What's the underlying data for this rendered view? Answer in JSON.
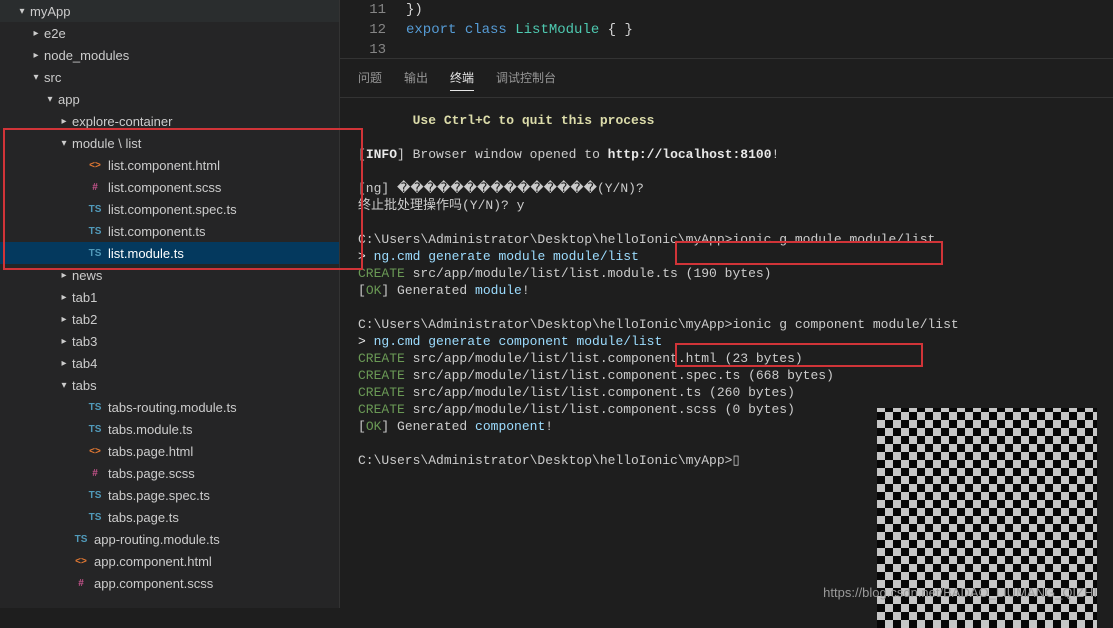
{
  "editor": {
    "lines": [
      {
        "num": "11",
        "html": "})"
      },
      {
        "num": "12",
        "html": "<span class='kw'>export</span> <span class='kw'>class</span> <span class='cls'>ListModule</span> { }"
      },
      {
        "num": "13",
        "html": ""
      }
    ]
  },
  "tree": [
    {
      "indent": 1,
      "chev": "▾",
      "icon": "",
      "cls": "",
      "label": "myApp"
    },
    {
      "indent": 2,
      "chev": "▸",
      "icon": "",
      "cls": "",
      "label": "e2e"
    },
    {
      "indent": 2,
      "chev": "▸",
      "icon": "",
      "cls": "",
      "label": "node_modules"
    },
    {
      "indent": 2,
      "chev": "▾",
      "icon": "",
      "cls": "",
      "label": "src"
    },
    {
      "indent": 3,
      "chev": "▾",
      "icon": "",
      "cls": "",
      "label": "app"
    },
    {
      "indent": 4,
      "chev": "▸",
      "icon": "",
      "cls": "",
      "label": "explore-container"
    },
    {
      "indent": 4,
      "chev": "▾",
      "icon": "",
      "cls": "",
      "label": "module \\ list"
    },
    {
      "indent": 5,
      "chev": "",
      "icon": "<>",
      "cls": "i-html",
      "label": "list.component.html"
    },
    {
      "indent": 5,
      "chev": "",
      "icon": "#",
      "cls": "i-scss",
      "label": "list.component.scss"
    },
    {
      "indent": 5,
      "chev": "",
      "icon": "TS",
      "cls": "i-ts",
      "label": "list.component.spec.ts"
    },
    {
      "indent": 5,
      "chev": "",
      "icon": "TS",
      "cls": "i-ts",
      "label": "list.component.ts"
    },
    {
      "indent": 5,
      "chev": "",
      "icon": "TS",
      "cls": "i-ts",
      "label": "list.module.ts",
      "selected": true
    },
    {
      "indent": 4,
      "chev": "▸",
      "icon": "",
      "cls": "",
      "label": "news"
    },
    {
      "indent": 4,
      "chev": "▸",
      "icon": "",
      "cls": "",
      "label": "tab1"
    },
    {
      "indent": 4,
      "chev": "▸",
      "icon": "",
      "cls": "",
      "label": "tab2"
    },
    {
      "indent": 4,
      "chev": "▸",
      "icon": "",
      "cls": "",
      "label": "tab3"
    },
    {
      "indent": 4,
      "chev": "▸",
      "icon": "",
      "cls": "",
      "label": "tab4"
    },
    {
      "indent": 4,
      "chev": "▾",
      "icon": "",
      "cls": "",
      "label": "tabs"
    },
    {
      "indent": 5,
      "chev": "",
      "icon": "TS",
      "cls": "i-ts",
      "label": "tabs-routing.module.ts"
    },
    {
      "indent": 5,
      "chev": "",
      "icon": "TS",
      "cls": "i-ts",
      "label": "tabs.module.ts"
    },
    {
      "indent": 5,
      "chev": "",
      "icon": "<>",
      "cls": "i-html",
      "label": "tabs.page.html"
    },
    {
      "indent": 5,
      "chev": "",
      "icon": "#",
      "cls": "i-scss",
      "label": "tabs.page.scss"
    },
    {
      "indent": 5,
      "chev": "",
      "icon": "TS",
      "cls": "i-ts",
      "label": "tabs.page.spec.ts"
    },
    {
      "indent": 5,
      "chev": "",
      "icon": "TS",
      "cls": "i-ts",
      "label": "tabs.page.ts"
    },
    {
      "indent": 4,
      "chev": "",
      "icon": "TS",
      "cls": "i-ts",
      "label": "app-routing.module.ts"
    },
    {
      "indent": 4,
      "chev": "",
      "icon": "<>",
      "cls": "i-html",
      "label": "app.component.html"
    },
    {
      "indent": 4,
      "chev": "",
      "icon": "#",
      "cls": "i-scss",
      "label": "app.component.scss"
    }
  ],
  "panelTabs": {
    "items": [
      "问题",
      "输出",
      "终端",
      "调试控制台"
    ],
    "activeIndex": 2
  },
  "terminal": {
    "lines": [
      {
        "cls": "ylw bld",
        "text": "       Use Ctrl+C to quit this process"
      },
      {
        "text": ""
      },
      {
        "html": "[<span class='wht bld'>INFO</span>] Browser window opened to <span class='wht bld'>http://localhost:8100</span>!"
      },
      {
        "text": ""
      },
      {
        "text": "[ng] ���������������(Y/N)?"
      },
      {
        "text": "终止批处理操作吗(Y/N)? y"
      },
      {
        "text": ""
      },
      {
        "text": "C:\\Users\\Administrator\\Desktop\\helloIonic\\myApp>ionic g module module/list"
      },
      {
        "html": "<span class='wht'>></span> <span class='cyn'>ng.cmd generate module module/list</span>"
      },
      {
        "html": "<span class='grn'>CREATE</span> src/app/module/list/list.module.ts (190 bytes)"
      },
      {
        "html": "[<span class='grn'>OK</span>] Generated <span class='cyn'>module</span>!"
      },
      {
        "text": ""
      },
      {
        "text": "C:\\Users\\Administrator\\Desktop\\helloIonic\\myApp>ionic g component module/list"
      },
      {
        "html": "<span class='wht'>></span> <span class='cyn'>ng.cmd generate component module/list</span>"
      },
      {
        "html": "<span class='grn'>CREATE</span> src/app/module/list/list.component.html (23 bytes)"
      },
      {
        "html": "<span class='grn'>CREATE</span> src/app/module/list/list.component.spec.ts (668 bytes)"
      },
      {
        "html": "<span class='grn'>CREATE</span> src/app/module/list/list.component.ts (260 bytes)"
      },
      {
        "html": "<span class='grn'>CREATE</span> src/app/module/list/list.component.scss (0 bytes)"
      },
      {
        "html": "[<span class='grn'>OK</span>] Generated <span class='cyn'>component</span>!"
      },
      {
        "text": ""
      },
      {
        "text": "C:\\Users\\Administrator\\Desktop\\helloIonic\\myApp>▯"
      }
    ]
  },
  "watermark": "https://blog.csdn.net/BADAO_LIUMANG_QIZHI"
}
